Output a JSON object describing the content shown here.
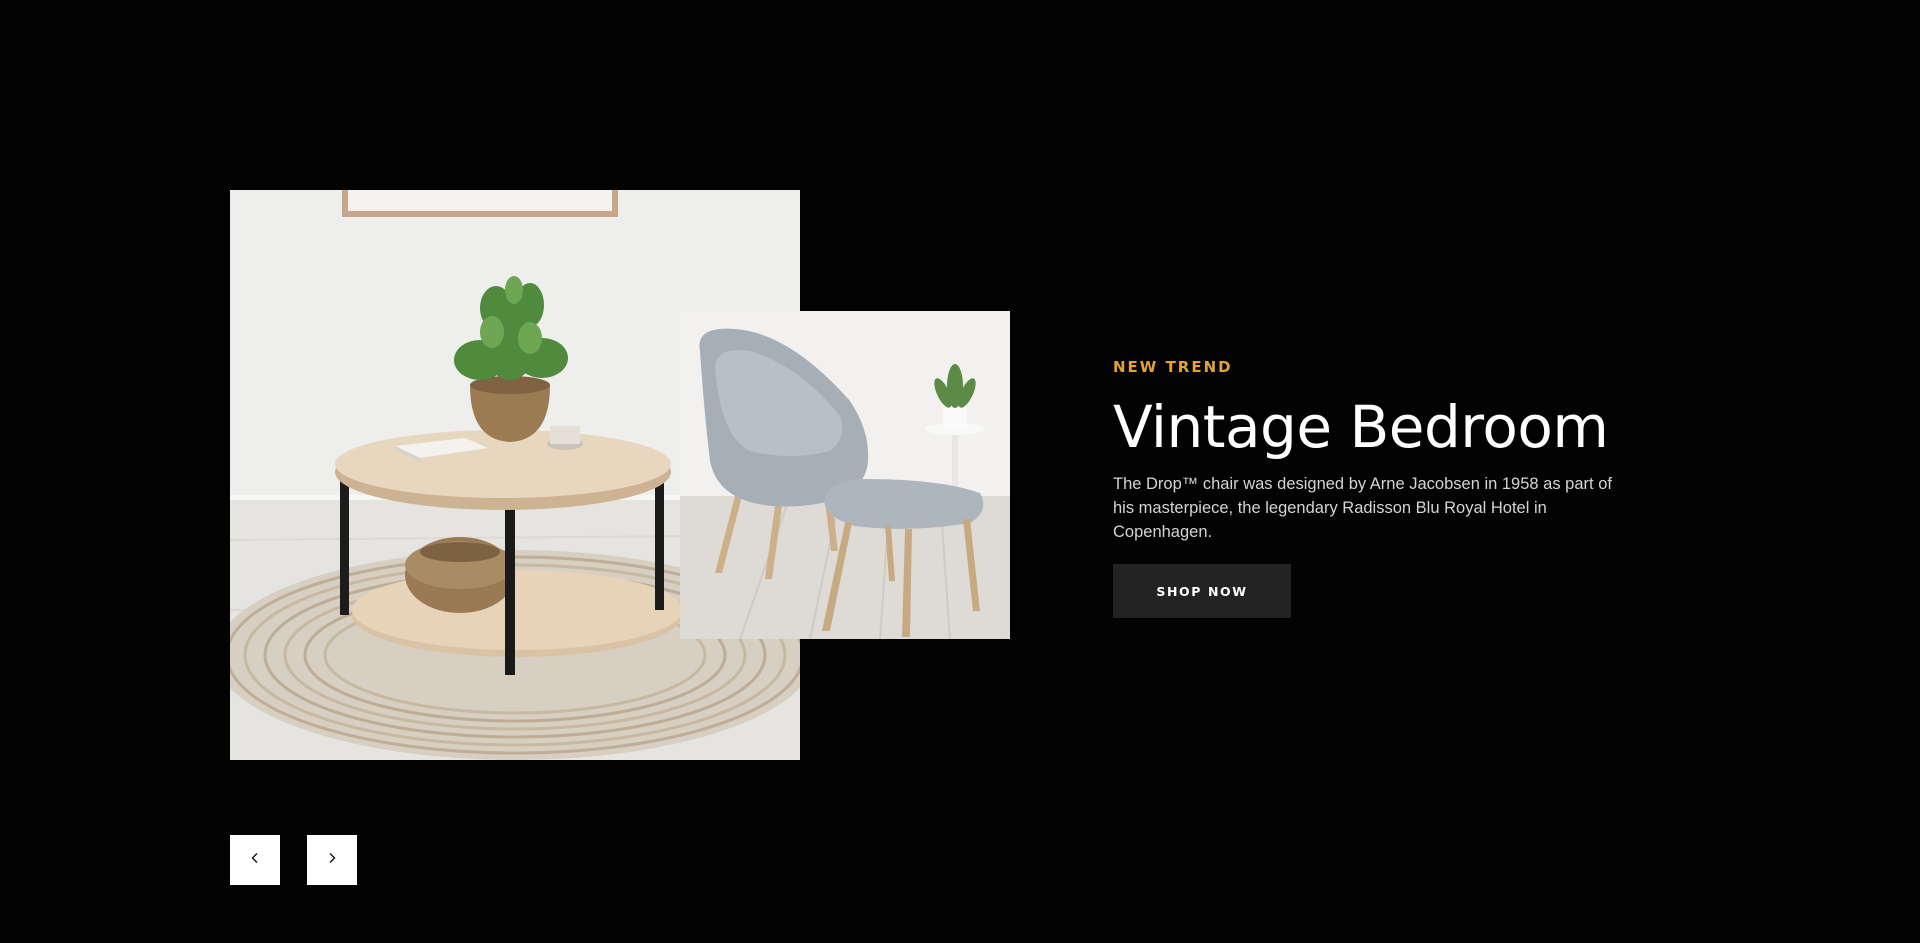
{
  "slide": {
    "eyebrow": "NEW TREND",
    "title": "Vintage Bedroom",
    "description": "The Drop™ chair was designed by Arne Jacobsen in 1958 as part of his masterpiece, the legendary Radisson Blu Royal Hotel in Copenhagen.",
    "cta_label": "SHOP NOW"
  },
  "images": {
    "main": "coffee-table-with-plant-and-rug",
    "secondary": "grey-lounge-chair-with-ottoman"
  },
  "slider": {
    "prev_icon": "chevron-left-icon",
    "next_icon": "chevron-right-icon"
  },
  "colors": {
    "background": "#030303",
    "accent": "#e2a23a",
    "heading": "#ffffff",
    "body_text": "#d4d4d4",
    "button_bg": "#232323",
    "arrow_bg": "#ffffff"
  }
}
